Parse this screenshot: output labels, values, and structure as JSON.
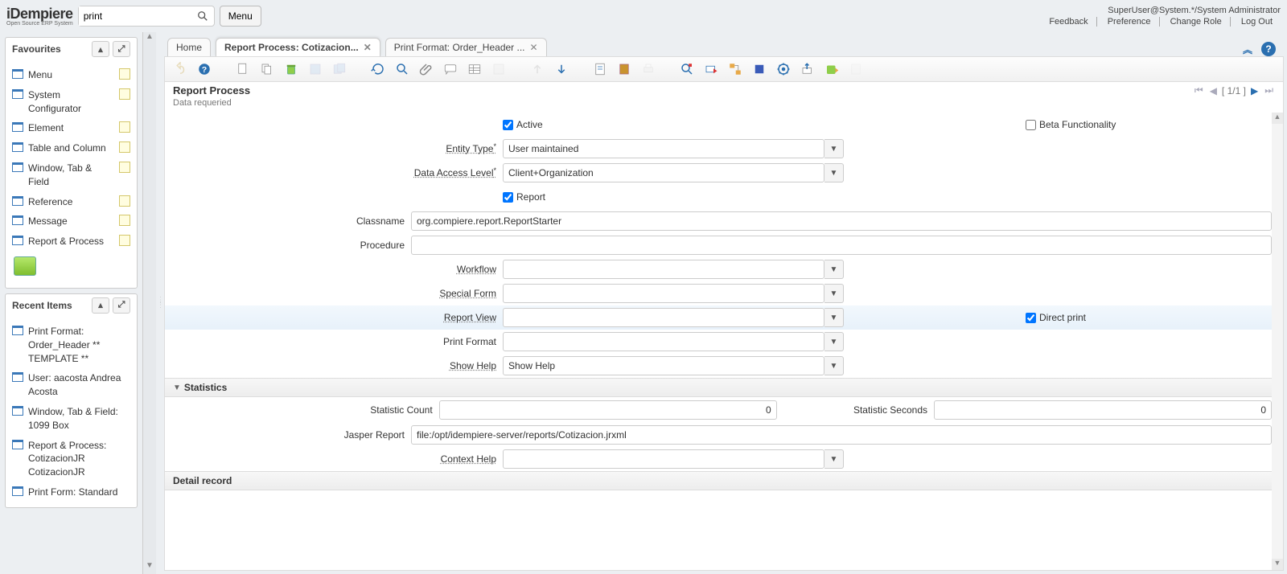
{
  "logo": {
    "main": "iDempiere",
    "sub": "Open Source ERP System"
  },
  "search": {
    "value": "print"
  },
  "menu_btn": "Menu",
  "user_line": "SuperUser@System.*/System Administrator",
  "top_links": [
    "Feedback",
    "Preference",
    "Change Role",
    "Log Out"
  ],
  "favourites": {
    "title": "Favourites",
    "items": [
      "Menu",
      "System Configurator",
      "Element",
      "Table and Column",
      "Window, Tab & Field",
      "Reference",
      "Message",
      "Report & Process"
    ]
  },
  "recent": {
    "title": "Recent Items",
    "items": [
      "Print Format: Order_Header ** TEMPLATE **",
      "User: aacosta Andrea Acosta",
      "Window, Tab & Field: 1099 Box",
      "Report & Process: CotizacionJR CotizacionJR",
      "Print Form: Standard"
    ]
  },
  "tabs": [
    "Home",
    "Report Process: Cotizacion...",
    "Print Format: Order_Header ..."
  ],
  "page": {
    "title": "Report Process",
    "msg": "Data requeried",
    "records": "[ 1/1 ]"
  },
  "form": {
    "active_lbl": "Active",
    "active": true,
    "beta_lbl": "Beta Functionality",
    "beta": false,
    "entity_type_lbl": "Entity Type",
    "entity_type": "User maintained",
    "dal_lbl": "Data Access Level",
    "dal": "Client+Organization",
    "report_lbl": "Report",
    "report": true,
    "class_lbl": "Classname",
    "class": "org.compiere.report.ReportStarter",
    "proc_lbl": "Procedure",
    "proc": "",
    "wf_lbl": "Workflow",
    "wf": "",
    "sf_lbl": "Special Form",
    "sf": "",
    "rv_lbl": "Report View",
    "rv": "",
    "dp_lbl": "Direct print",
    "dp": true,
    "pf_lbl": "Print Format",
    "pf": "",
    "sh_lbl": "Show Help",
    "sh": "Show Help",
    "stats_title": "Statistics",
    "sc_lbl": "Statistic Count",
    "sc": "0",
    "ss_lbl": "Statistic Seconds",
    "ss": "0",
    "jr_lbl": "Jasper Report",
    "jr": "file:/opt/idempiere-server/reports/Cotizacion.jrxml",
    "ch_lbl": "Context Help",
    "ch": "",
    "detail": "Detail record"
  }
}
